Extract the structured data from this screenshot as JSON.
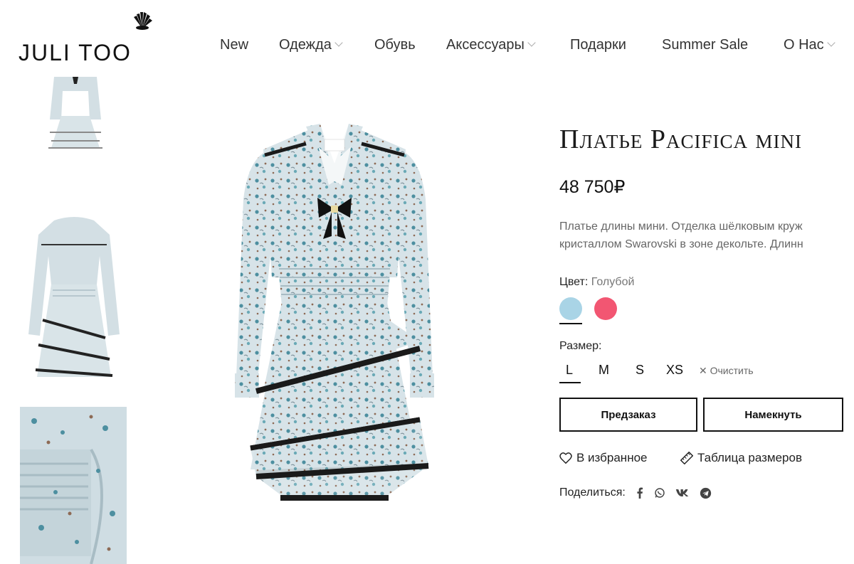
{
  "brand": {
    "logo_text": "JULI TOO"
  },
  "nav": {
    "items": [
      {
        "label": "New",
        "has_dropdown": false
      },
      {
        "label": "Одежда",
        "has_dropdown": true
      },
      {
        "label": "Обувь",
        "has_dropdown": false
      },
      {
        "label": "Аксессуары",
        "has_dropdown": true
      },
      {
        "label": "Подарки",
        "has_dropdown": false
      },
      {
        "label": "Summer Sale",
        "has_dropdown": false
      },
      {
        "label": "О Нас",
        "has_dropdown": true
      }
    ]
  },
  "product": {
    "title": "Платье Pacifica mini",
    "price": "48 750₽",
    "description_lines": [
      "Платье длины мини. Отделка шёлковым круж",
      "кристаллом Swarovski в зоне декольте. Длинн"
    ],
    "color_label": "Цвет:",
    "color_value": "Голубой",
    "colors": [
      {
        "name": "Голубой",
        "hex": "#a9d4e6",
        "selected": true
      },
      {
        "name": "Розовый",
        "hex": "#f25672",
        "selected": false
      }
    ],
    "size_label": "Размер:",
    "sizes": [
      {
        "label": "L",
        "selected": true
      },
      {
        "label": "M",
        "selected": false
      },
      {
        "label": "S",
        "selected": false
      },
      {
        "label": "XS",
        "selected": false
      }
    ],
    "clear_label": "Очистить",
    "preorder_label": "Предзаказ",
    "hint_label": "Намекнуть",
    "wishlist_label": "В избранное",
    "size_table_label": "Таблица размеров",
    "share_label": "Поделиться:",
    "share_icons": [
      "facebook-icon",
      "whatsapp-icon",
      "vk-icon",
      "telegram-icon"
    ]
  },
  "colors": {
    "fabric": "#d7e3e8",
    "fabric_print_teal": "#4d8fa0",
    "fabric_print_brown": "#8d6a55",
    "trim": "#1a1a1a"
  }
}
